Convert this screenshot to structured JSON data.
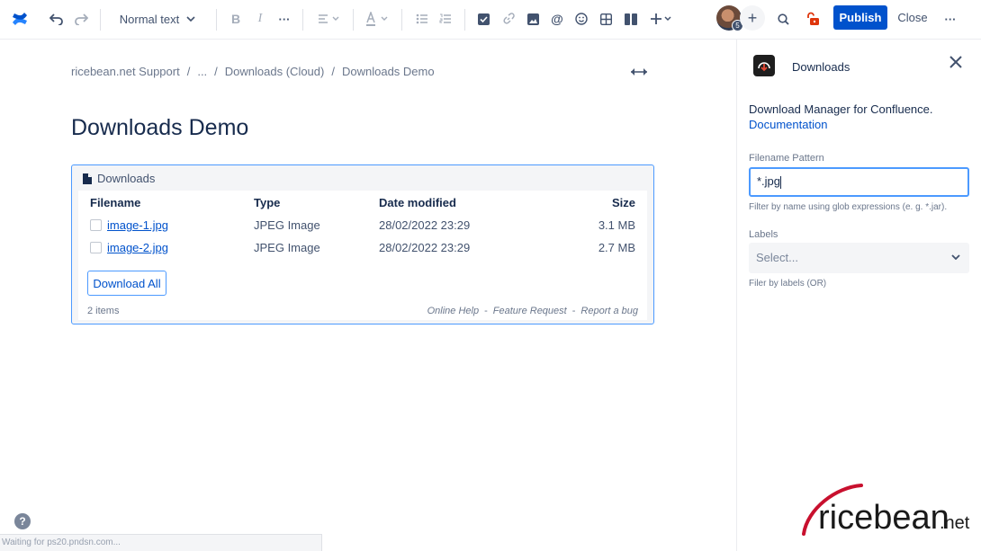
{
  "toolbar": {
    "text_style": "Normal text",
    "publish_label": "Publish",
    "close_label": "Close",
    "avatar_badge": "5"
  },
  "breadcrumb": [
    "ricebean.net Support",
    "...",
    "Downloads (Cloud)",
    "Downloads Demo"
  ],
  "page": {
    "title": "Downloads Demo"
  },
  "macro": {
    "header": "Downloads",
    "columns": {
      "filename": "Filename",
      "type": "Type",
      "date": "Date modified",
      "size": "Size"
    },
    "rows": [
      {
        "filename": "image-1.jpg",
        "type": "JPEG Image",
        "date": "28/02/2022 23:29",
        "size": "3.1 MB"
      },
      {
        "filename": "image-2.jpg",
        "type": "JPEG Image",
        "date": "28/02/2022 23:29",
        "size": "2.7 MB"
      }
    ],
    "download_all": "Download All",
    "items_count": "2 items",
    "footer_links": [
      "Online Help",
      "Feature Request",
      "Report a bug"
    ]
  },
  "panel": {
    "title": "Downloads",
    "description": "Download Manager for Confluence.",
    "doc_link": "Documentation",
    "filename_label": "Filename Pattern",
    "filename_value": "*.jpg",
    "filename_help": "Filter by name using glob expressions (e. g. *.jar).",
    "labels_label": "Labels",
    "labels_placeholder": "Select...",
    "labels_help": "Filer by labels (OR)",
    "logo_text": "ricebean",
    "logo_suffix": ".net"
  },
  "status": {
    "text": "Waiting for ps20.pndsn.com..."
  },
  "colors": {
    "accent": "#0052cc",
    "focus": "#4c9aff",
    "brand_red": "#c8102e"
  }
}
